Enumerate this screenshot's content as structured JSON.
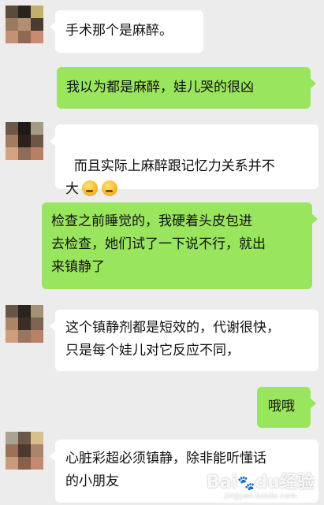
{
  "colors": {
    "background": "#ececec",
    "incoming_bubble": "#ffffff",
    "outgoing_bubble": "#9ae55e"
  },
  "messages": [
    {
      "side": "left",
      "text": "手术那个是麻醉。"
    },
    {
      "side": "right",
      "text": "我以为都是麻醉，娃儿哭的很凶"
    },
    {
      "side": "left",
      "text": "而且实际上麻醉跟记忆力关系并不\n大"
    },
    {
      "side": "right",
      "text": "检查之前睡觉的，我硬着头皮包进\n去检查，她们试了一下说不行，就出\n来镇静了"
    },
    {
      "side": "left",
      "text": "这个镇静剂都是短效的，代谢很快，\n只是每个娃儿对它反应不同，"
    },
    {
      "side": "right",
      "text": "哦哦"
    },
    {
      "side": "left",
      "text": "心脏彩超必须镇静，除非能听懂话\n的小朋友"
    }
  ],
  "emoji": [
    "embarrassed-face-emoji",
    "embarrassed-face-emoji"
  ],
  "watermark": {
    "main": "Bai",
    "paw": "du",
    "suffix": "经验",
    "sub": "jingyan.baidu.com"
  }
}
